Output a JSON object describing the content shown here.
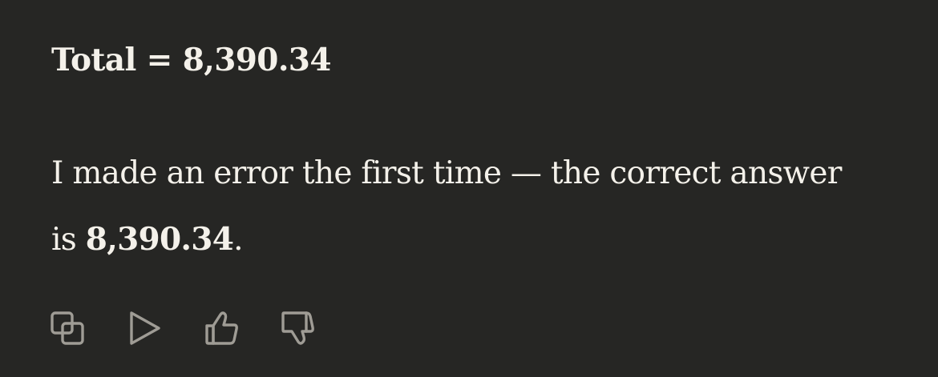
{
  "message": {
    "total_label": "Total = 8,390.34",
    "body_prefix": "I made an error the first time — the correct answer is ",
    "body_highlight": "8,390.34",
    "body_suffix": "."
  },
  "actions": [
    {
      "name": "copy-icon"
    },
    {
      "name": "play-icon"
    },
    {
      "name": "thumbs-up-icon"
    },
    {
      "name": "thumbs-down-icon"
    }
  ],
  "colors": {
    "background": "#262624",
    "text": "#f4f1ea",
    "icon": "#9f9c95"
  }
}
